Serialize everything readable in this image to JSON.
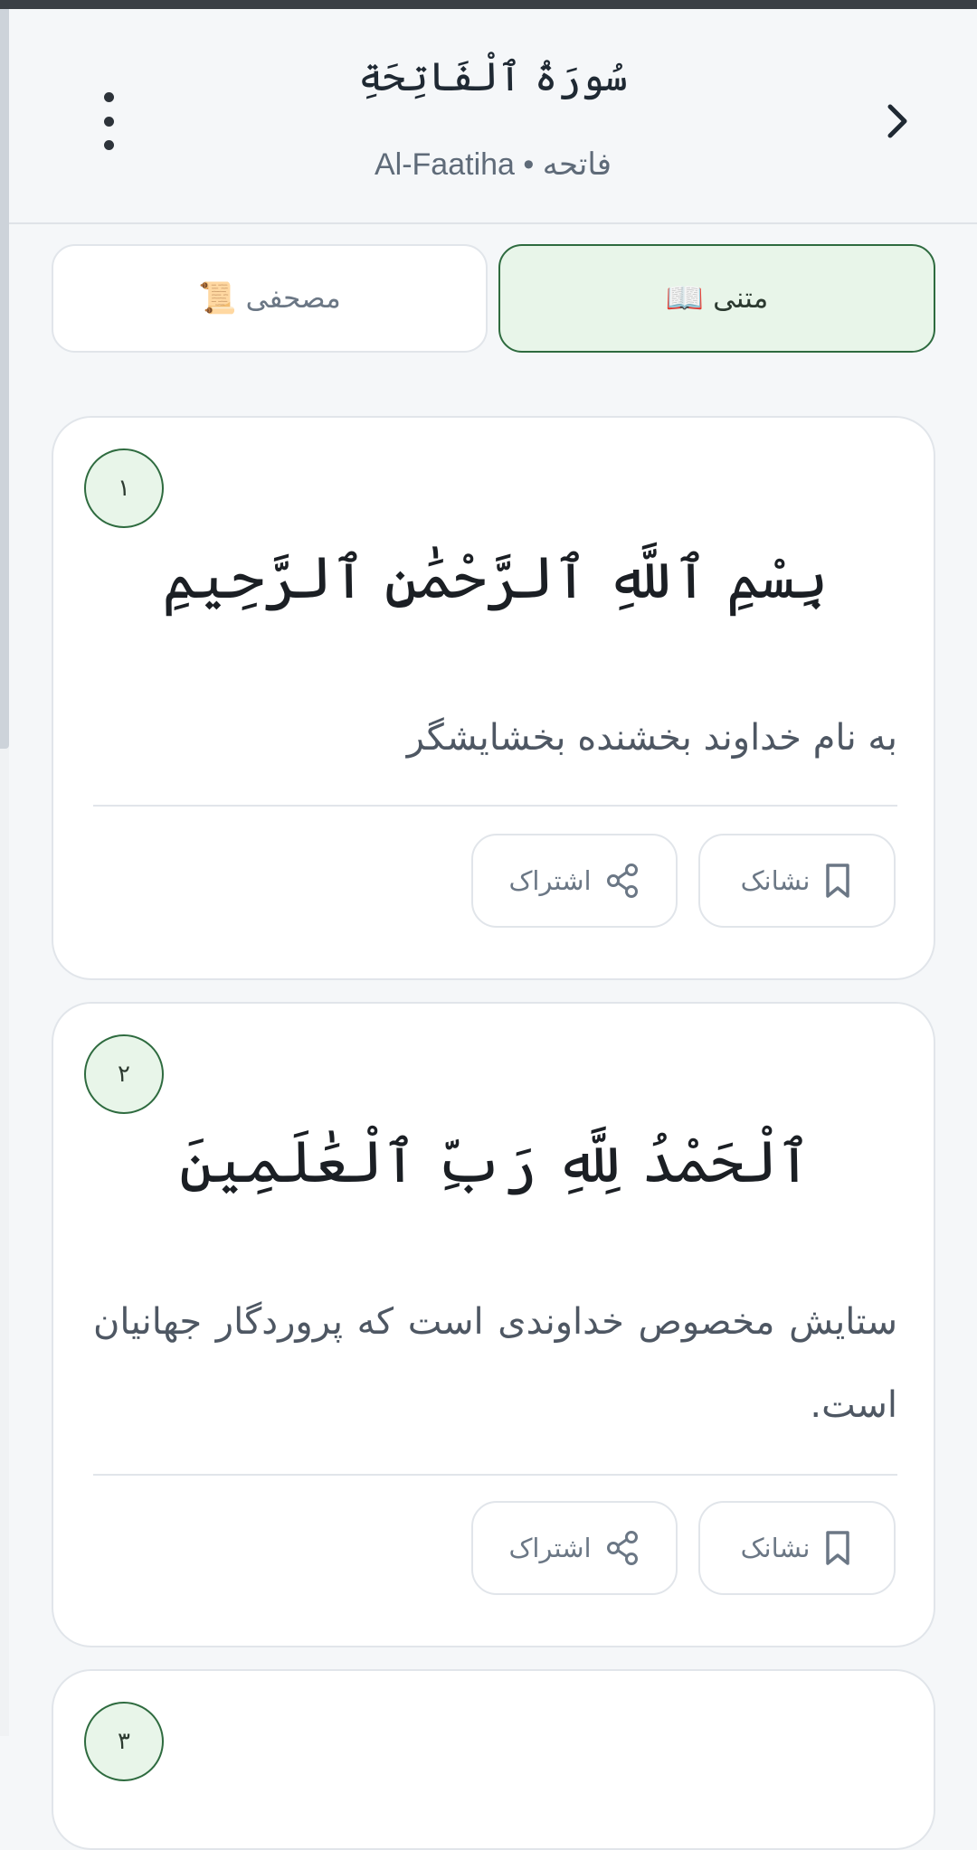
{
  "header": {
    "title": "سُورَةُ ٱلْفَاتِحَةِ",
    "subtitle": "Al-Faatiha • فاتحه",
    "more_icon": "more-vertical-icon",
    "next_icon": "chevron-right-icon"
  },
  "tabs": [
    {
      "label": "مصحفی",
      "emoji": "📜",
      "active": false
    },
    {
      "label": "متنی",
      "emoji": "📖",
      "active": true
    }
  ],
  "colors": {
    "accent_green": "#2e6b3f",
    "active_tab_bg": "#e8f5e9",
    "background": "#f5f7f9"
  },
  "verses": [
    {
      "number": "۱",
      "arabic": "بِسْمِ ٱللَّهِ ٱلرَّحْمَٰنِ ٱلرَّحِيمِ",
      "translation": "به نام خداوند بخشنده بخشایشگر",
      "bookmark_label": "نشانک",
      "share_label": "اشتراک"
    },
    {
      "number": "۲",
      "arabic": "ٱلْحَمْدُ لِلَّهِ رَبِّ ٱلْعَٰلَمِينَ",
      "translation": "ستایش مخصوص خداوندی است که پروردگار جهانیان است.",
      "bookmark_label": "نشانک",
      "share_label": "اشتراک"
    },
    {
      "number": "۳"
    }
  ]
}
